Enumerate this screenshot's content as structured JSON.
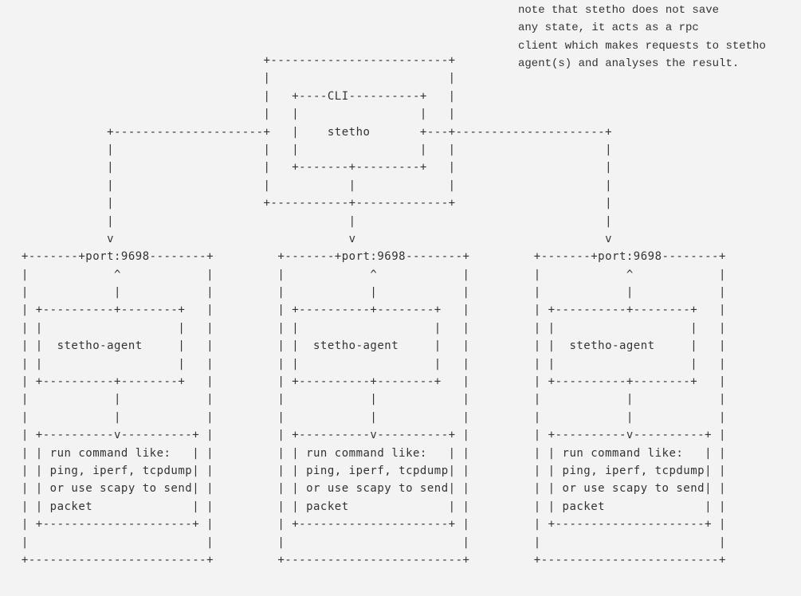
{
  "note": "note that stetho does not save\nany state, it acts as a rpc\nclient which makes requests to stetho\nagent(s) and analyses the result.",
  "diagram": {
    "cli_label": "CLI",
    "cli_name": "stetho",
    "port": "port:9698",
    "agent_name": "stetho-agent",
    "agent_cmd_lines": [
      "run command like:",
      "ping, iperf, tcpdump",
      "or use scapy to send",
      "packet"
    ]
  },
  "ascii": "                                   +-------------------------+\n                                   |                         |\n                                   |   +----CLI----------+   |\n                                   |   |                 |   |\n             +---------------------+   |    stetho       +---+---------------------+\n             |                     |   |                 |   |                     |\n             |                     |   +-------+---------+   |                     |\n             |                     |           |             |                     |\n             |                     +-----------+-------------+                     |\n             |                                 |                                   |\n             v                                 v                                   v\n +-------+port:9698--------+         +-------+port:9698--------+         +-------+port:9698--------+\n |            ^            |         |            ^            |         |            ^            |\n |            |            |         |            |            |         |            |            |\n | +----------+--------+   |         | +----------+--------+   |         | +----------+--------+   |\n | |                   |   |         | |                   |   |         | |                   |   |\n | |  stetho-agent     |   |         | |  stetho-agent     |   |         | |  stetho-agent     |   |\n | |                   |   |         | |                   |   |         | |                   |   |\n | +----------+--------+   |         | +----------+--------+   |         | +----------+--------+   |\n |            |            |         |            |            |         |            |            |\n |            |            |         |            |            |         |            |            |\n | +----------v----------+ |         | +----------v----------+ |         | +----------v----------+ |\n | | run command like:   | |         | | run command like:   | |         | | run command like:   | |\n | | ping, iperf, tcpdump| |         | | ping, iperf, tcpdump| |         | | ping, iperf, tcpdump| |\n | | or use scapy to send| |         | | or use scapy to send| |         | | or use scapy to send| |\n | | packet              | |         | | packet              | |         | | packet              | |\n | +---------------------+ |         | +---------------------+ |         | +---------------------+ |\n |                         |         |                         |         |                         |\n +-------------------------+         +-------------------------+         +-------------------------+"
}
